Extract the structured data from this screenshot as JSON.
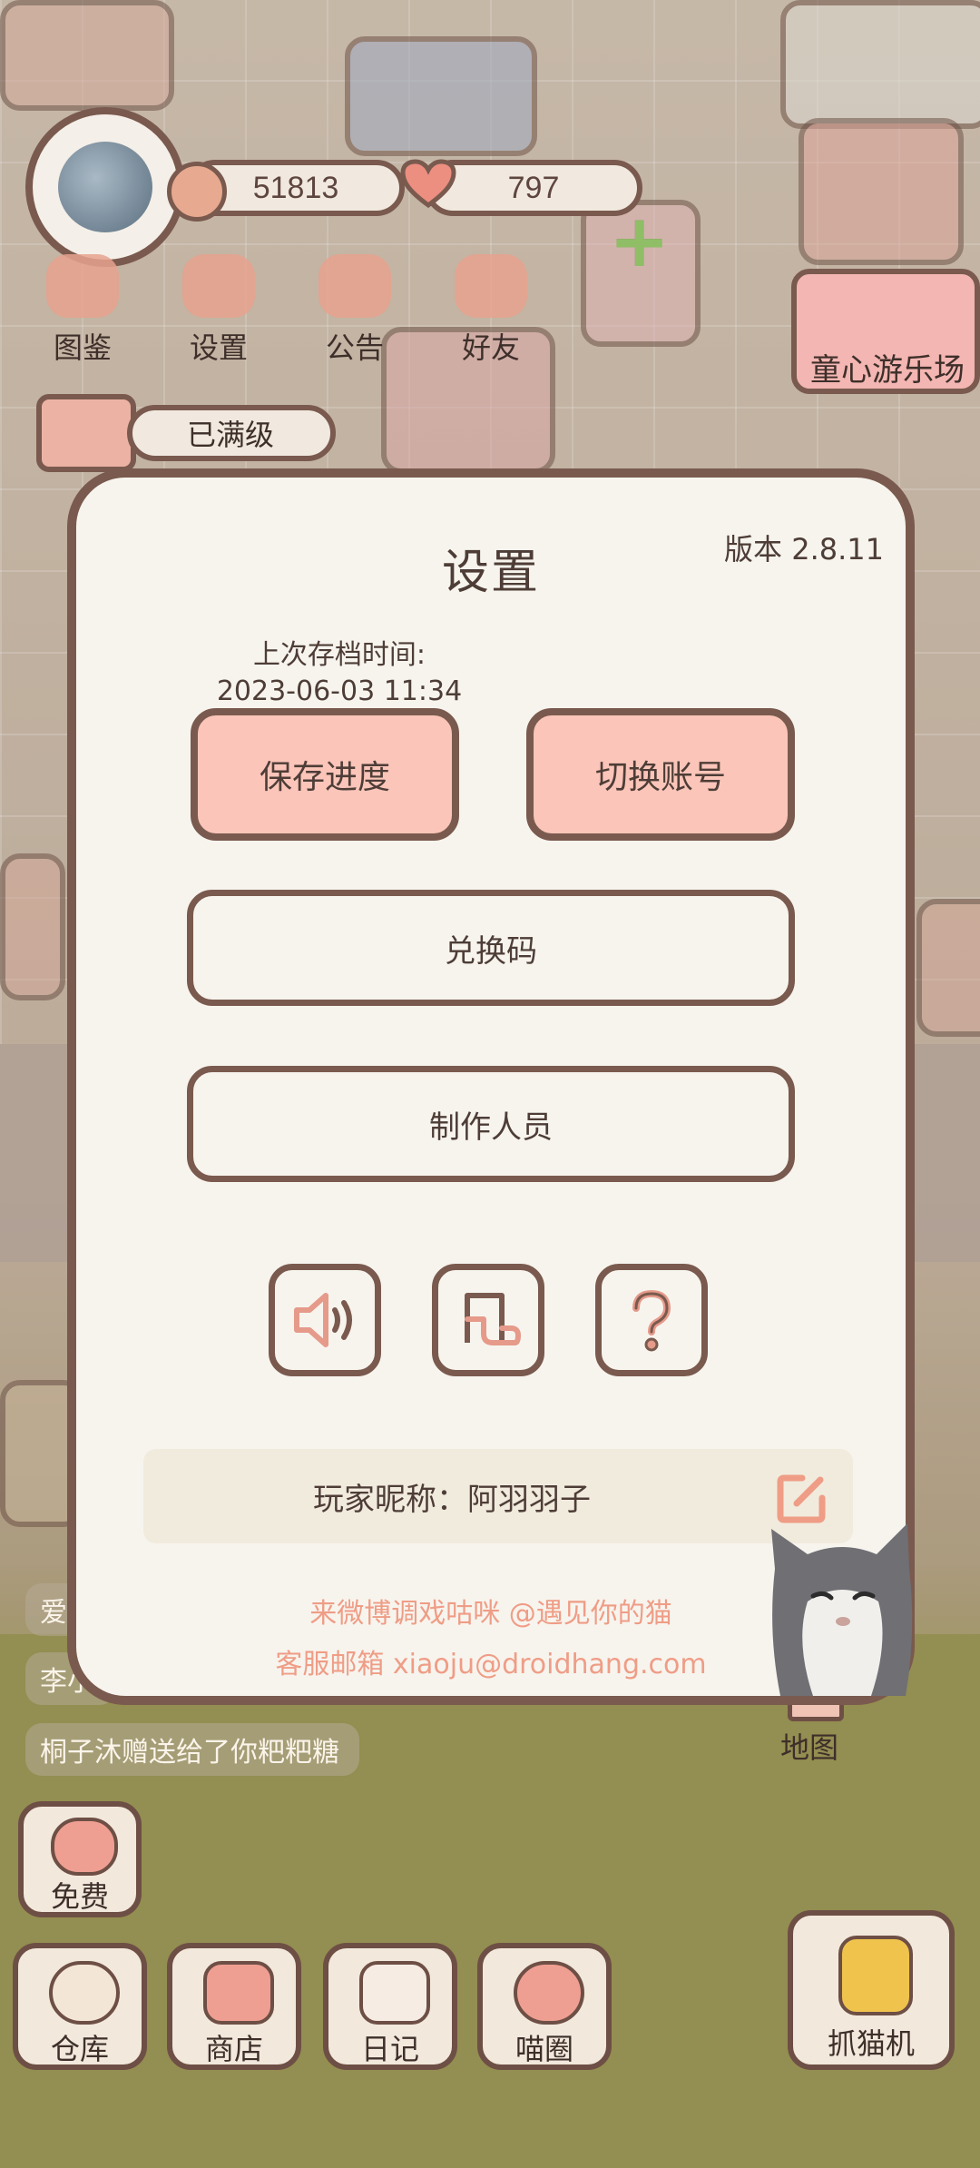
{
  "hud": {
    "coins": "51813",
    "hearts": "797",
    "level_status": "已满级",
    "location_sign": "童心游乐场"
  },
  "top_buttons": [
    {
      "label": "图鉴",
      "icon": "cat-face-icon"
    },
    {
      "label": "设置",
      "icon": "gear-icon"
    },
    {
      "label": "公告",
      "icon": "gift-icon"
    },
    {
      "label": "好友",
      "icon": "friends-icon"
    }
  ],
  "dialog": {
    "title": "设置",
    "version": "版本 2.8.11",
    "last_save_label": "上次存档时间:",
    "last_save_time": "2023-06-03 11:34",
    "save_button": "保存进度",
    "switch_account_button": "切换账号",
    "redeem_button": "兑换码",
    "credits_button": "制作人员",
    "icon_buttons": [
      "speaker-icon",
      "music-note-icon",
      "question-mark-icon"
    ],
    "nickname_label": "玩家昵称：阿羽羽子",
    "promo_weibo": "来微博调戏咕咪 @遇见你的猫",
    "promo_email": "客服邮箱 xiaoju@droidhang.com"
  },
  "chat": {
    "partial_1": "爱",
    "partial_2": "李小",
    "gift_message": "桐子沐赠送给了你粑粑糖"
  },
  "bottom": {
    "free_label": "免费",
    "map_label": "地图",
    "dock": [
      {
        "label": "仓库",
        "icon": "storage-icon"
      },
      {
        "label": "商店",
        "icon": "shop-icon"
      },
      {
        "label": "日记",
        "icon": "diary-icon"
      },
      {
        "label": "喵圈",
        "icon": "cat-planet-icon"
      }
    ],
    "claw_label": "抓猫机"
  },
  "colors": {
    "border": "#7a5a4e",
    "dialog_bg": "#f7f4ee",
    "pink_button": "#fbc5b9",
    "promo_text": "#ef9d86"
  }
}
